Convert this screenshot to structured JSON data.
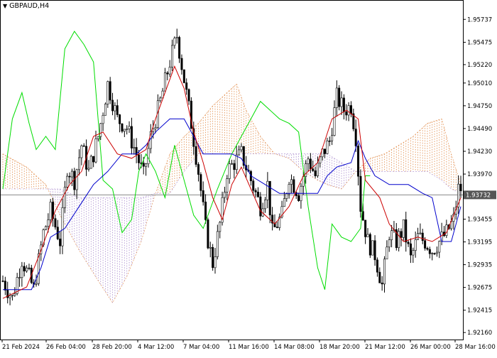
{
  "symbol": "GBPAUD,H4",
  "current_price_label": "1.93732",
  "colors": {
    "background": "#ffffff",
    "candle": "#000000",
    "tenkan": "#cc0000",
    "kijun": "#0000cc",
    "chikou": "#00dd00",
    "kumo_bull": "#e08844",
    "kumo_bear": "#a888cc",
    "price_line": "#888888"
  },
  "chart_data": {
    "type": "candlestick",
    "indicator": "Ichimoku Kinko Hyo",
    "ylim": [
      1.9208,
      1.9595
    ],
    "y_ticks": [
      "1.95737",
      "1.95475",
      "1.95220",
      "1.95010",
      "1.94750",
      "1.94490",
      "1.94230",
      "1.93970",
      "1.93710",
      "1.93455",
      "1.93195",
      "1.92935",
      "1.92675",
      "1.92415",
      "1.92160"
    ],
    "x_ticks": [
      "21 Feb 2024",
      "26 Feb 04:00",
      "28 Feb 20:00",
      "4 Mar 12:00",
      "7 Mar 04:00",
      "11 Mar 16:00",
      "14 Mar 08:00",
      "18 Mar 20:00",
      "21 Mar 12:00",
      "26 Mar 00:00",
      "28 Mar 16:00"
    ],
    "current_price": 1.93732,
    "close_path": [
      [
        0,
        1.9275
      ],
      [
        4,
        1.9255
      ],
      [
        8,
        1.93
      ],
      [
        13,
        1.9265
      ],
      [
        17,
        1.933
      ],
      [
        20,
        1.9355
      ],
      [
        24,
        1.932
      ],
      [
        27,
        1.9405
      ],
      [
        30,
        1.939
      ],
      [
        33,
        1.943
      ],
      [
        36,
        1.94
      ],
      [
        40,
        1.944
      ],
      [
        44,
        1.95
      ],
      [
        48,
        1.946
      ],
      [
        52,
        1.945
      ],
      [
        56,
        1.942
      ],
      [
        59,
        1.9395
      ],
      [
        62,
        1.944
      ],
      [
        66,
        1.948
      ],
      [
        70,
        1.9525
      ],
      [
        73,
        1.9555
      ],
      [
        76,
        1.9505
      ],
      [
        79,
        1.9455
      ],
      [
        82,
        1.94
      ],
      [
        85,
        1.9335
      ],
      [
        88,
        1.9295
      ],
      [
        91,
        1.934
      ],
      [
        94,
        1.94
      ],
      [
        97,
        1.941
      ],
      [
        100,
        1.942
      ],
      [
        104,
        1.939
      ],
      [
        108,
        1.936
      ],
      [
        111,
        1.9385
      ],
      [
        113,
        1.933
      ],
      [
        117,
        1.935
      ],
      [
        120,
        1.9395
      ],
      [
        124,
        1.9375
      ],
      [
        128,
        1.9415
      ],
      [
        131,
        1.9395
      ],
      [
        134,
        1.942
      ],
      [
        137,
        1.9435
      ],
      [
        140,
        1.9485
      ],
      [
        143,
        1.947
      ],
      [
        146,
        1.9475
      ],
      [
        148,
        1.944
      ],
      [
        150,
        1.936
      ],
      [
        153,
        1.932
      ],
      [
        156,
        1.9305
      ],
      [
        159,
        1.927
      ],
      [
        162,
        1.933
      ],
      [
        165,
        1.932
      ],
      [
        168,
        1.9335
      ],
      [
        171,
        1.93
      ],
      [
        174,
        1.9325
      ],
      [
        177,
        1.932
      ],
      [
        180,
        1.931
      ],
      [
        183,
        1.932
      ],
      [
        186,
        1.933
      ],
      [
        189,
        1.9345
      ],
      [
        191,
        1.938
      ],
      [
        192,
        1.938
      ]
    ],
    "tenkan_path": [
      [
        0,
        1.9255
      ],
      [
        10,
        1.9268
      ],
      [
        16,
        1.931
      ],
      [
        22,
        1.9355
      ],
      [
        28,
        1.9385
      ],
      [
        33,
        1.94
      ],
      [
        38,
        1.944
      ],
      [
        42,
        1.9445
      ],
      [
        48,
        1.942
      ],
      [
        54,
        1.9415
      ],
      [
        60,
        1.9425
      ],
      [
        64,
        1.946
      ],
      [
        68,
        1.949
      ],
      [
        72,
        1.952
      ],
      [
        76,
        1.9495
      ],
      [
        80,
        1.9445
      ],
      [
        84,
        1.941
      ],
      [
        88,
        1.937
      ],
      [
        92,
        1.9345
      ],
      [
        96,
        1.9385
      ],
      [
        100,
        1.9405
      ],
      [
        104,
        1.938
      ],
      [
        108,
        1.9355
      ],
      [
        114,
        1.934
      ],
      [
        120,
        1.936
      ],
      [
        126,
        1.9395
      ],
      [
        132,
        1.941
      ],
      [
        138,
        1.946
      ],
      [
        144,
        1.947
      ],
      [
        149,
        1.946
      ],
      [
        152,
        1.939
      ],
      [
        158,
        1.937
      ],
      [
        162,
        1.934
      ],
      [
        168,
        1.932
      ],
      [
        174,
        1.9325
      ],
      [
        180,
        1.932
      ],
      [
        186,
        1.933
      ],
      [
        192,
        1.937
      ]
    ],
    "kijun_path": [
      [
        0,
        1.9265
      ],
      [
        12,
        1.9265
      ],
      [
        16,
        1.929
      ],
      [
        20,
        1.9325
      ],
      [
        26,
        1.9335
      ],
      [
        32,
        1.936
      ],
      [
        38,
        1.9385
      ],
      [
        44,
        1.94
      ],
      [
        50,
        1.942
      ],
      [
        56,
        1.942
      ],
      [
        60,
        1.943
      ],
      [
        64,
        1.9445
      ],
      [
        70,
        1.946
      ],
      [
        76,
        1.946
      ],
      [
        80,
        1.944
      ],
      [
        84,
        1.942
      ],
      [
        90,
        1.942
      ],
      [
        96,
        1.942
      ],
      [
        100,
        1.9415
      ],
      [
        104,
        1.9395
      ],
      [
        110,
        1.9385
      ],
      [
        116,
        1.9375
      ],
      [
        124,
        1.9375
      ],
      [
        132,
        1.9375
      ],
      [
        136,
        1.9395
      ],
      [
        140,
        1.9405
      ],
      [
        146,
        1.941
      ],
      [
        149,
        1.9435
      ],
      [
        152,
        1.9415
      ],
      [
        156,
        1.9395
      ],
      [
        162,
        1.9385
      ],
      [
        170,
        1.9385
      ],
      [
        176,
        1.9375
      ],
      [
        180,
        1.937
      ],
      [
        184,
        1.932
      ],
      [
        188,
        1.932
      ],
      [
        192,
        1.936
      ]
    ],
    "chikou_path": [
      [
        0,
        1.938
      ],
      [
        4,
        1.946
      ],
      [
        8,
        1.949
      ],
      [
        11,
        1.9455
      ],
      [
        14,
        1.9425
      ],
      [
        18,
        1.944
      ],
      [
        22,
        1.9425
      ],
      [
        26,
        1.954
      ],
      [
        30,
        1.956
      ],
      [
        34,
        1.9545
      ],
      [
        38,
        1.9525
      ],
      [
        42,
        1.939
      ],
      [
        46,
        1.938
      ],
      [
        50,
        1.933
      ],
      [
        54,
        1.9345
      ],
      [
        57,
        1.94
      ],
      [
        60,
        1.942
      ],
      [
        64,
        1.94
      ],
      [
        68,
        1.937
      ],
      [
        72,
        1.943
      ],
      [
        76,
        1.939
      ],
      [
        80,
        1.935
      ],
      [
        84,
        1.9335
      ],
      [
        90,
        1.938
      ],
      [
        96,
        1.942
      ],
      [
        100,
        1.944
      ],
      [
        104,
        1.946
      ],
      [
        108,
        1.948
      ],
      [
        112,
        1.947
      ],
      [
        116,
        1.946
      ],
      [
        120,
        1.9455
      ],
      [
        124,
        1.9445
      ],
      [
        128,
        1.936
      ],
      [
        132,
        1.929
      ],
      [
        135,
        1.9265
      ],
      [
        138,
        1.934
      ],
      [
        142,
        1.9325
      ],
      [
        146,
        1.932
      ],
      [
        150,
        1.9335
      ],
      [
        152,
        1.9395
      ],
      [
        154,
        1.9395
      ]
    ],
    "span_a_path": [
      [
        0,
        1.942
      ],
      [
        10,
        1.9405
      ],
      [
        18,
        1.9385
      ],
      [
        24,
        1.935
      ],
      [
        32,
        1.931
      ],
      [
        40,
        1.9275
      ],
      [
        46,
        1.925
      ],
      [
        52,
        1.928
      ],
      [
        58,
        1.932
      ],
      [
        64,
        1.9375
      ],
      [
        70,
        1.942
      ],
      [
        76,
        1.944
      ],
      [
        82,
        1.9455
      ],
      [
        88,
        1.9475
      ],
      [
        94,
        1.949
      ],
      [
        98,
        1.95
      ],
      [
        102,
        1.947
      ],
      [
        108,
        1.944
      ],
      [
        114,
        1.942
      ],
      [
        120,
        1.9415
      ],
      [
        126,
        1.94
      ],
      [
        132,
        1.939
      ],
      [
        136,
        1.9385
      ],
      [
        142,
        1.938
      ],
      [
        148,
        1.94
      ],
      [
        154,
        1.9415
      ],
      [
        160,
        1.942
      ],
      [
        166,
        1.943
      ],
      [
        172,
        1.944
      ],
      [
        178,
        1.9455
      ],
      [
        184,
        1.946
      ],
      [
        188,
        1.942
      ],
      [
        192,
        1.9385
      ]
    ],
    "span_b_path": [
      [
        0,
        1.938
      ],
      [
        10,
        1.938
      ],
      [
        18,
        1.938
      ],
      [
        24,
        1.938
      ],
      [
        32,
        1.937
      ],
      [
        40,
        1.937
      ],
      [
        46,
        1.937
      ],
      [
        52,
        1.937
      ],
      [
        58,
        1.937
      ],
      [
        64,
        1.9375
      ],
      [
        70,
        1.9375
      ],
      [
        76,
        1.94
      ],
      [
        82,
        1.942
      ],
      [
        88,
        1.942
      ],
      [
        94,
        1.942
      ],
      [
        98,
        1.942
      ],
      [
        102,
        1.942
      ],
      [
        108,
        1.942
      ],
      [
        114,
        1.942
      ],
      [
        120,
        1.942
      ],
      [
        126,
        1.942
      ],
      [
        132,
        1.942
      ],
      [
        136,
        1.942
      ],
      [
        142,
        1.941
      ],
      [
        148,
        1.94
      ],
      [
        154,
        1.94
      ],
      [
        160,
        1.94
      ],
      [
        166,
        1.94
      ],
      [
        172,
        1.94
      ],
      [
        178,
        1.94
      ],
      [
        184,
        1.939
      ],
      [
        188,
        1.938
      ],
      [
        192,
        1.9375
      ]
    ]
  }
}
